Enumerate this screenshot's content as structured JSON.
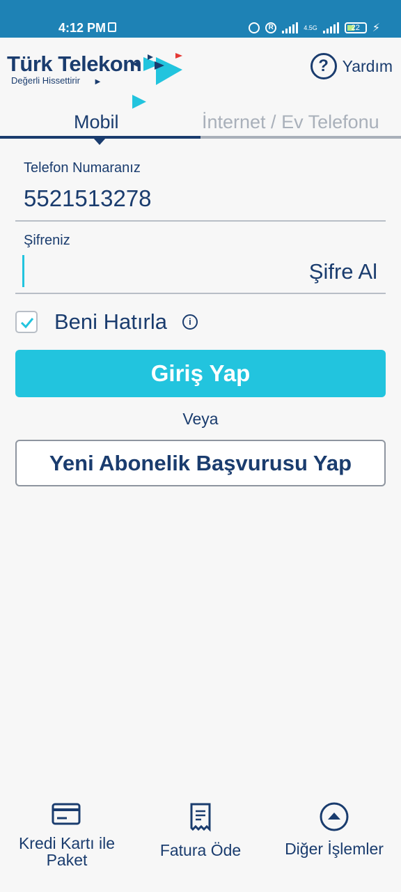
{
  "status_bar": {
    "time": "4:12 PM",
    "network": "4.5G",
    "battery": "22"
  },
  "header": {
    "brand_name": "Türk Telekom",
    "brand_tagline": "Değerli Hissettirir",
    "help_label": "Yardım"
  },
  "tabs": [
    {
      "label": "Mobil",
      "active": true
    },
    {
      "label": "İnternet / Ev Telefonu",
      "active": false
    }
  ],
  "form": {
    "phone_label": "Telefon Numaranız",
    "phone_value": "5521513278",
    "password_label": "Şifreniz",
    "password_value": "",
    "get_password_label": "Şifre Al",
    "remember_label": "Beni Hatırla",
    "remember_checked": true,
    "login_label": "Giriş Yap",
    "or_label": "Veya",
    "new_subscription_label": "Yeni Abonelik Başvurusu Yap"
  },
  "bottom_nav": [
    {
      "label": "Kredi Kartı ile Paket",
      "icon": "credit-card-icon"
    },
    {
      "label": "Fatura Öde",
      "icon": "receipt-icon"
    },
    {
      "label": "Diğer İşlemler",
      "icon": "expand-up-icon"
    }
  ],
  "colors": {
    "primary": "#1a3c6e",
    "accent": "#22c4de",
    "status_bar": "#1e82b5"
  }
}
